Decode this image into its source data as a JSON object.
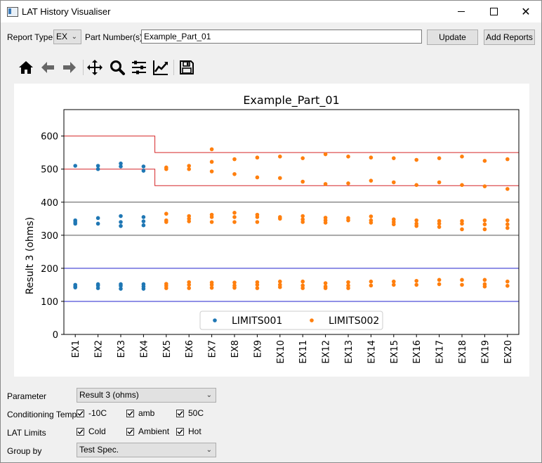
{
  "window": {
    "title": "LAT History Visualiser"
  },
  "controls": {
    "report_type_label": "Report Type",
    "report_type_value": "EX",
    "part_numbers_label": "Part Number(s)",
    "part_numbers_value": "Example_Part_01",
    "update_label": "Update",
    "add_reports_label": "Add Reports"
  },
  "toolbar": [
    "home-icon",
    "back-arrow-icon",
    "forward-arrow-icon",
    "pan-icon",
    "zoom-icon",
    "configure-subplots-icon",
    "edit-axes-icon",
    "save-icon"
  ],
  "chart_data": {
    "type": "scatter",
    "title": "Example_Part_01",
    "ylabel": "Result 3 (ohms)",
    "xlabel": "",
    "categories": [
      "EX1",
      "EX2",
      "EX3",
      "EX4",
      "EX5",
      "EX6",
      "EX7",
      "EX8",
      "EX9",
      "EX10",
      "EX11",
      "EX12",
      "EX13",
      "EX14",
      "EX15",
      "EX16",
      "EX17",
      "EX18",
      "EX19",
      "EX20"
    ],
    "ylim": [
      0,
      680
    ],
    "yticks": [
      0,
      100,
      200,
      300,
      400,
      500,
      600
    ],
    "grid": false,
    "legend_position": "bottom-center",
    "series": [
      {
        "name": "LIMITS001",
        "color": "#1f77b4",
        "points": [
          [
            1,
            510
          ],
          [
            1,
            345
          ],
          [
            1,
            340
          ],
          [
            1,
            335
          ],
          [
            1,
            150
          ],
          [
            1,
            145
          ],
          [
            1,
            142
          ],
          [
            2,
            510
          ],
          [
            2,
            500
          ],
          [
            2,
            352
          ],
          [
            2,
            335
          ],
          [
            2,
            152
          ],
          [
            2,
            148
          ],
          [
            2,
            140
          ],
          [
            3,
            517
          ],
          [
            3,
            508
          ],
          [
            3,
            358
          ],
          [
            3,
            340
          ],
          [
            3,
            328
          ],
          [
            3,
            152
          ],
          [
            3,
            147
          ],
          [
            3,
            138
          ],
          [
            4,
            508
          ],
          [
            4,
            495
          ],
          [
            4,
            355
          ],
          [
            4,
            342
          ],
          [
            4,
            330
          ],
          [
            4,
            152
          ],
          [
            4,
            145
          ],
          [
            4,
            138
          ]
        ]
      },
      {
        "name": "LIMITS002",
        "color": "#ff7f0e",
        "points": [
          [
            5,
            505
          ],
          [
            5,
            500
          ],
          [
            5,
            365
          ],
          [
            5,
            345
          ],
          [
            5,
            340
          ],
          [
            5,
            153
          ],
          [
            5,
            147
          ],
          [
            5,
            140
          ],
          [
            6,
            510
          ],
          [
            6,
            500
          ],
          [
            6,
            358
          ],
          [
            6,
            350
          ],
          [
            6,
            342
          ],
          [
            6,
            158
          ],
          [
            6,
            150
          ],
          [
            6,
            140
          ],
          [
            7,
            560
          ],
          [
            7,
            522
          ],
          [
            7,
            493
          ],
          [
            7,
            362
          ],
          [
            7,
            355
          ],
          [
            7,
            340
          ],
          [
            7,
            157
          ],
          [
            7,
            150
          ],
          [
            7,
            141
          ],
          [
            8,
            530
          ],
          [
            8,
            485
          ],
          [
            8,
            368
          ],
          [
            8,
            355
          ],
          [
            8,
            340
          ],
          [
            8,
            157
          ],
          [
            8,
            148
          ],
          [
            8,
            141
          ],
          [
            9,
            535
          ],
          [
            9,
            475
          ],
          [
            9,
            362
          ],
          [
            9,
            355
          ],
          [
            9,
            340
          ],
          [
            9,
            158
          ],
          [
            9,
            150
          ],
          [
            9,
            140
          ],
          [
            10,
            538
          ],
          [
            10,
            473
          ],
          [
            10,
            355
          ],
          [
            10,
            350
          ],
          [
            10,
            160
          ],
          [
            10,
            150
          ],
          [
            10,
            143
          ],
          [
            11,
            533
          ],
          [
            11,
            462
          ],
          [
            11,
            358
          ],
          [
            11,
            348
          ],
          [
            11,
            340
          ],
          [
            11,
            160
          ],
          [
            11,
            148
          ],
          [
            11,
            140
          ],
          [
            12,
            545
          ],
          [
            12,
            455
          ],
          [
            12,
            353
          ],
          [
            12,
            345
          ],
          [
            12,
            338
          ],
          [
            12,
            155
          ],
          [
            12,
            145
          ],
          [
            12,
            140
          ],
          [
            13,
            538
          ],
          [
            13,
            457
          ],
          [
            13,
            352
          ],
          [
            13,
            345
          ],
          [
            13,
            158
          ],
          [
            13,
            148
          ],
          [
            13,
            140
          ],
          [
            14,
            535
          ],
          [
            14,
            465
          ],
          [
            14,
            357
          ],
          [
            14,
            345
          ],
          [
            14,
            338
          ],
          [
            14,
            160
          ],
          [
            14,
            148
          ],
          [
            15,
            533
          ],
          [
            15,
            460
          ],
          [
            15,
            348
          ],
          [
            15,
            340
          ],
          [
            15,
            333
          ],
          [
            15,
            160
          ],
          [
            15,
            150
          ],
          [
            16,
            528
          ],
          [
            16,
            452
          ],
          [
            16,
            345
          ],
          [
            16,
            335
          ],
          [
            16,
            328
          ],
          [
            16,
            162
          ],
          [
            16,
            150
          ],
          [
            17,
            533
          ],
          [
            17,
            460
          ],
          [
            17,
            343
          ],
          [
            17,
            335
          ],
          [
            17,
            325
          ],
          [
            17,
            165
          ],
          [
            17,
            152
          ],
          [
            18,
            538
          ],
          [
            18,
            452
          ],
          [
            18,
            343
          ],
          [
            18,
            335
          ],
          [
            18,
            318
          ],
          [
            18,
            165
          ],
          [
            18,
            150
          ],
          [
            19,
            525
          ],
          [
            19,
            448
          ],
          [
            19,
            345
          ],
          [
            19,
            333
          ],
          [
            19,
            318
          ],
          [
            19,
            165
          ],
          [
            19,
            152
          ],
          [
            19,
            145
          ],
          [
            20,
            530
          ],
          [
            20,
            440
          ],
          [
            20,
            345
          ],
          [
            20,
            333
          ],
          [
            20,
            322
          ],
          [
            20,
            160
          ],
          [
            20,
            147
          ]
        ]
      }
    ],
    "limit_lines": [
      {
        "color": "#d62728",
        "points": [
          [
            0.5,
            600
          ],
          [
            4.5,
            600
          ],
          [
            4.5,
            550
          ],
          [
            20.5,
            550
          ]
        ]
      },
      {
        "color": "#d62728",
        "points": [
          [
            0.5,
            500
          ],
          [
            4.5,
            500
          ],
          [
            4.5,
            450
          ],
          [
            20.5,
            450
          ]
        ]
      },
      {
        "color": "#555555",
        "points": [
          [
            0.5,
            400
          ],
          [
            20.5,
            400
          ]
        ]
      },
      {
        "color": "#555555",
        "points": [
          [
            0.5,
            300
          ],
          [
            20.5,
            300
          ]
        ]
      },
      {
        "color": "#2222cc",
        "points": [
          [
            0.5,
            200
          ],
          [
            20.5,
            200
          ]
        ]
      },
      {
        "color": "#2222cc",
        "points": [
          [
            0.5,
            100
          ],
          [
            20.5,
            100
          ]
        ]
      }
    ]
  },
  "bottom": {
    "parameter_label": "Parameter",
    "parameter_value": "Result 3 (ohms)",
    "conditioning_label": "Conditioning Temp.",
    "conditioning_options": [
      "-10C",
      "amb",
      "50C"
    ],
    "lat_limits_label": "LAT Limits",
    "lat_limits_options": [
      "Cold",
      "Ambient",
      "Hot"
    ],
    "group_by_label": "Group by",
    "group_by_value": "Test Spec."
  }
}
